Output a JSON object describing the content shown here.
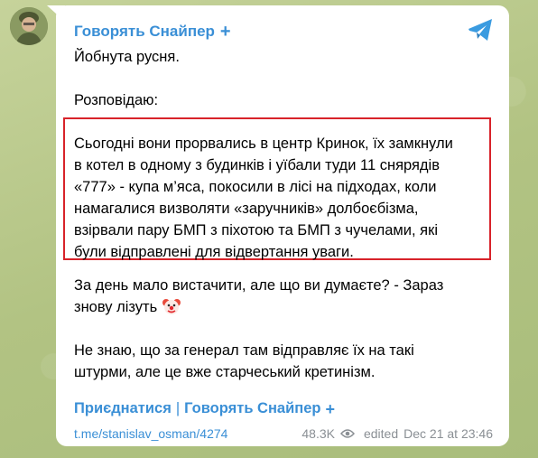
{
  "channel": {
    "name": "Говорять Снайпер",
    "badge": "+"
  },
  "post": {
    "line1": "Йобнута русня.",
    "line2": "Розповідаю:",
    "highlight_lines": [
      "Сьогодні вони прорвались в центр Кринок, їх замкнули",
      "в котел в одному з будинків і уїбали туди 11 снярядів",
      "«777» - купа м’яса, покосили в лісі на підходах, коли",
      "намагалися визволяти «заручників» долбоєбізма,",
      "взірвали пару БМП з піхотою та БМП з чучелами, які",
      "були відправлені для відвертання уваги."
    ],
    "para3_lines": [
      "За день мало вистачити, але що ви думаєте? - Зараз",
      "знову лізуть"
    ],
    "para3_emoji": "clown-face-icon",
    "para4_lines": [
      "Не знаю, що за генерал там відправляє їх на такі",
      "штурми, але це вже старчеський кретинізм."
    ]
  },
  "footer": {
    "join_label": "Приєднатися",
    "separator": "|",
    "channel_link": "Говорять Снайпер",
    "channel_badge": "+"
  },
  "meta": {
    "link": "t.me/stanislav_osman/4274",
    "views": "48.3K",
    "edited_label": "edited",
    "date": "Dec 21 at 23:46"
  },
  "colors": {
    "accent": "#3a8fd6",
    "highlight_border": "#d8232a"
  }
}
